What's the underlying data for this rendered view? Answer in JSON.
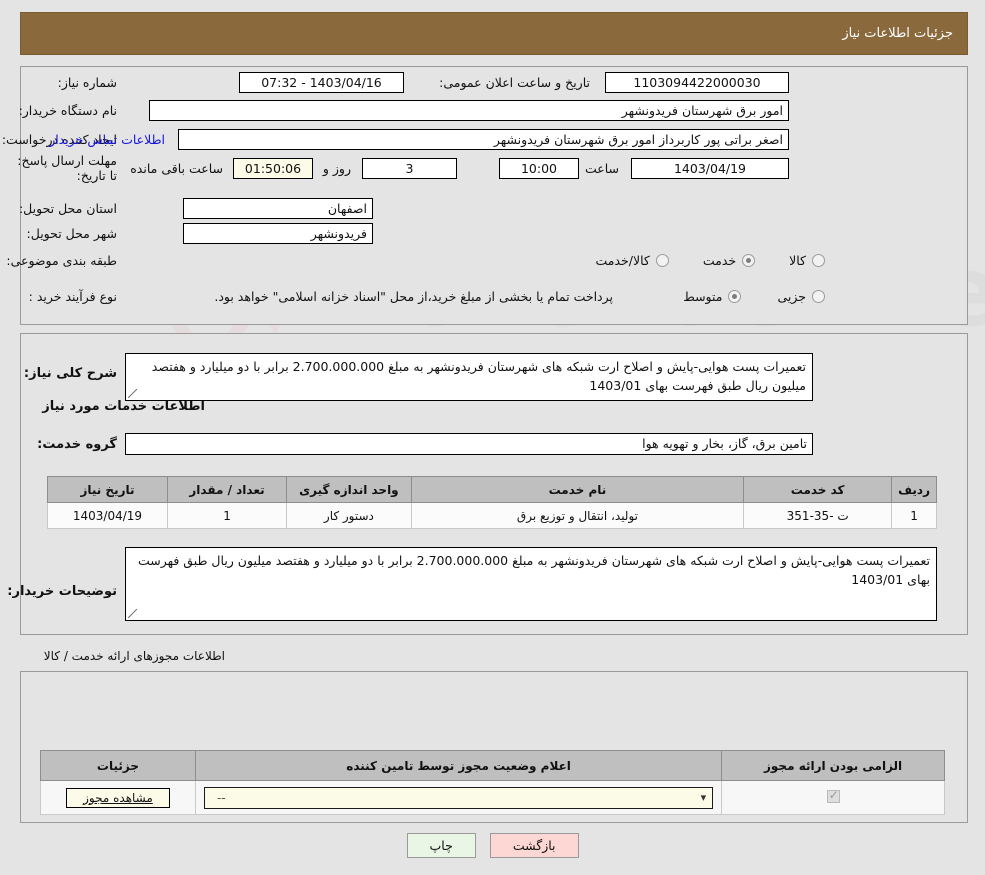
{
  "header": {
    "title": "جزئیات اطلاعات نیاز",
    "bar_color": "#8a6a3d"
  },
  "form": {
    "need_number_label": "شماره نیاز:",
    "need_number_value": "1103094422000030",
    "announce_label": "تاریخ و ساعت اعلان عمومی:",
    "announce_value": "1403/04/16 - 07:32",
    "buyer_org_label": "نام دستگاه خریدار:",
    "buyer_org_value": "امور برق شهرستان فریدونشهر",
    "creator_label": "ایجاد کننده درخواست:",
    "creator_value": "اصغر براتی پور کاربرداز امور برق شهرستان فریدونشهر",
    "contact_link": "اطلاعات تماس خریدار",
    "deadline_label": "مهلت ارسال پاسخ: تا تاریخ:",
    "deadline_date": "1403/04/19",
    "deadline_hour_label": "ساعت",
    "deadline_hour": "10:00",
    "days_left": "3",
    "days_unit": "روز و",
    "time_left": "01:50:06",
    "time_left_suffix": "ساعت باقی مانده",
    "province_label": "استان محل تحویل:",
    "province_value": "اصفهان",
    "city_label": "شهر محل تحویل:",
    "city_value": "فریدونشهر",
    "category_label": "طبقه بندی موضوعی:",
    "category_options": [
      {
        "label": "کالا",
        "selected": false
      },
      {
        "label": "خدمت",
        "selected": true
      },
      {
        "label": "کالا/خدمت",
        "selected": false
      }
    ],
    "process_label": "نوع فرآیند خرید :",
    "process_options": [
      {
        "label": "جزیی",
        "selected": false
      },
      {
        "label": "متوسط",
        "selected": true
      }
    ],
    "process_note": "پرداخت تمام یا بخشی از مبلغ خرید،از محل \"اسناد خزانه اسلامی\" خواهد بود."
  },
  "description": {
    "label": "شرح کلی نیاز:",
    "value": "تعمیرات پست هوایی-پایش و اصلاح ارت شبکه های شهرستان فریدونشهر به مبلغ 2.700.000.000 برابر با دو میلیارد و هفتصد  میلیون ریال طبق فهرست بهای 1403/01"
  },
  "services_section": {
    "heading": "اطلاعات خدمات مورد نیاز",
    "group_label": "گروه خدمت:",
    "group_value": "تامین برق، گاز، بخار و تهویه هوا",
    "table": {
      "columns": [
        "ردیف",
        "کد خدمت",
        "نام خدمت",
        "واحد اندازه گیری",
        "تعداد / مقدار",
        "تاریخ نیاز"
      ],
      "rows": [
        [
          "1",
          "ت -35-351",
          "تولید، انتقال و توزیع برق",
          "دستور کار",
          "1",
          "1403/04/19"
        ]
      ]
    }
  },
  "buyer_notes": {
    "label": "توضیحات خریدار:",
    "value": "تعمیرات پست هوایی-پایش و اصلاح ارت شبکه های شهرستان فریدونشهر به مبلغ 2.700.000.000 برابر با دو میلیارد و هفتصد  میلیون ریال طبق فهرست بهای 1403/01"
  },
  "licenses": {
    "heading": "اطلاعات مجوزهای ارائه خدمت / کالا",
    "table": {
      "columns": [
        "الزامی بودن ارائه مجوز",
        "اعلام وضعیت مجوز توسط تامین کننده",
        "جزئیات"
      ],
      "row": {
        "required_checked": true,
        "status_value": "--",
        "status_caret": "⌄",
        "details_button": "مشاهده مجوز"
      }
    }
  },
  "footer": {
    "print_label": "چاپ",
    "back_label": "بازگشت"
  },
  "watermark": {
    "text": "AriaTender.net"
  }
}
